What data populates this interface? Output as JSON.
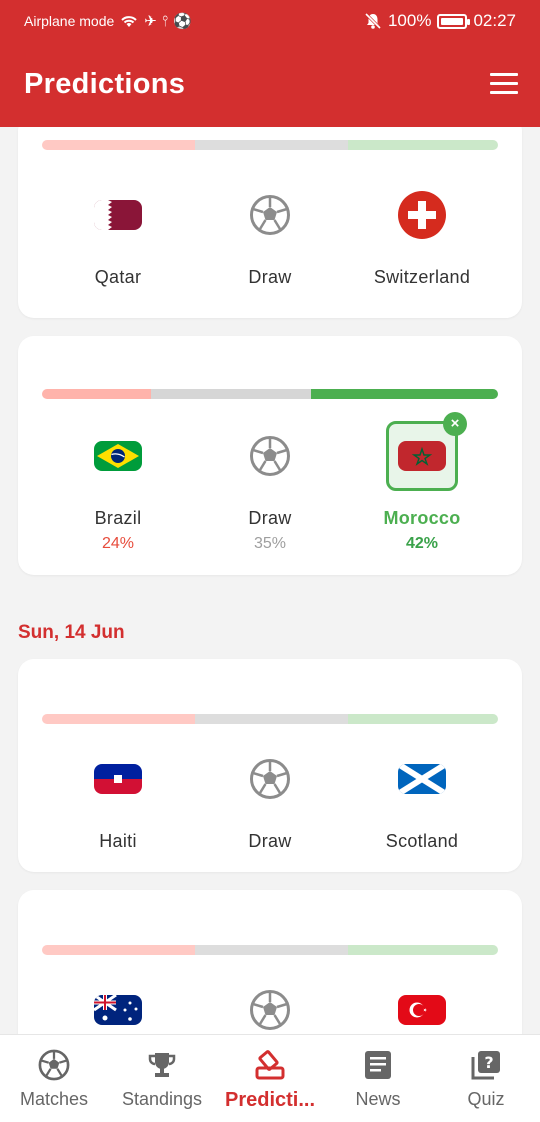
{
  "status_bar": {
    "left_text": "Airplane mode",
    "battery": "100%",
    "time": "02:27"
  },
  "header": {
    "title": "Predictions"
  },
  "matches": [
    {
      "home": "Qatar",
      "draw": "Draw",
      "away": "Switzerland",
      "bar": [
        0.335,
        0.335,
        0.33
      ]
    },
    {
      "home": "Brazil",
      "draw": "Draw",
      "away": "Morocco",
      "home_pct": "24%",
      "draw_pct": "35%",
      "away_pct": "42%",
      "selected": "away",
      "bar": [
        0.24,
        0.35,
        0.41
      ]
    },
    {
      "home": "Haiti",
      "draw": "Draw",
      "away": "Scotland",
      "bar": [
        0.335,
        0.335,
        0.33
      ]
    },
    {
      "home": "",
      "draw": "",
      "away": "",
      "bar": [
        0.335,
        0.335,
        0.33
      ]
    }
  ],
  "date_header": "Sun, 14 Jun",
  "bottom_nav": [
    {
      "label": "Matches",
      "icon": "football-icon"
    },
    {
      "label": "Standings",
      "icon": "trophy-icon"
    },
    {
      "label": "Predicti...",
      "icon": "prediction-icon",
      "active": true
    },
    {
      "label": "News",
      "icon": "newspaper-icon"
    },
    {
      "label": "Quiz",
      "icon": "quiz-icon"
    }
  ],
  "colors": {
    "brand": "#d32f2f",
    "home": "#ffc9c4",
    "draw": "#dddddd",
    "away": "#cbe8c9",
    "selected": "#4caf50"
  }
}
